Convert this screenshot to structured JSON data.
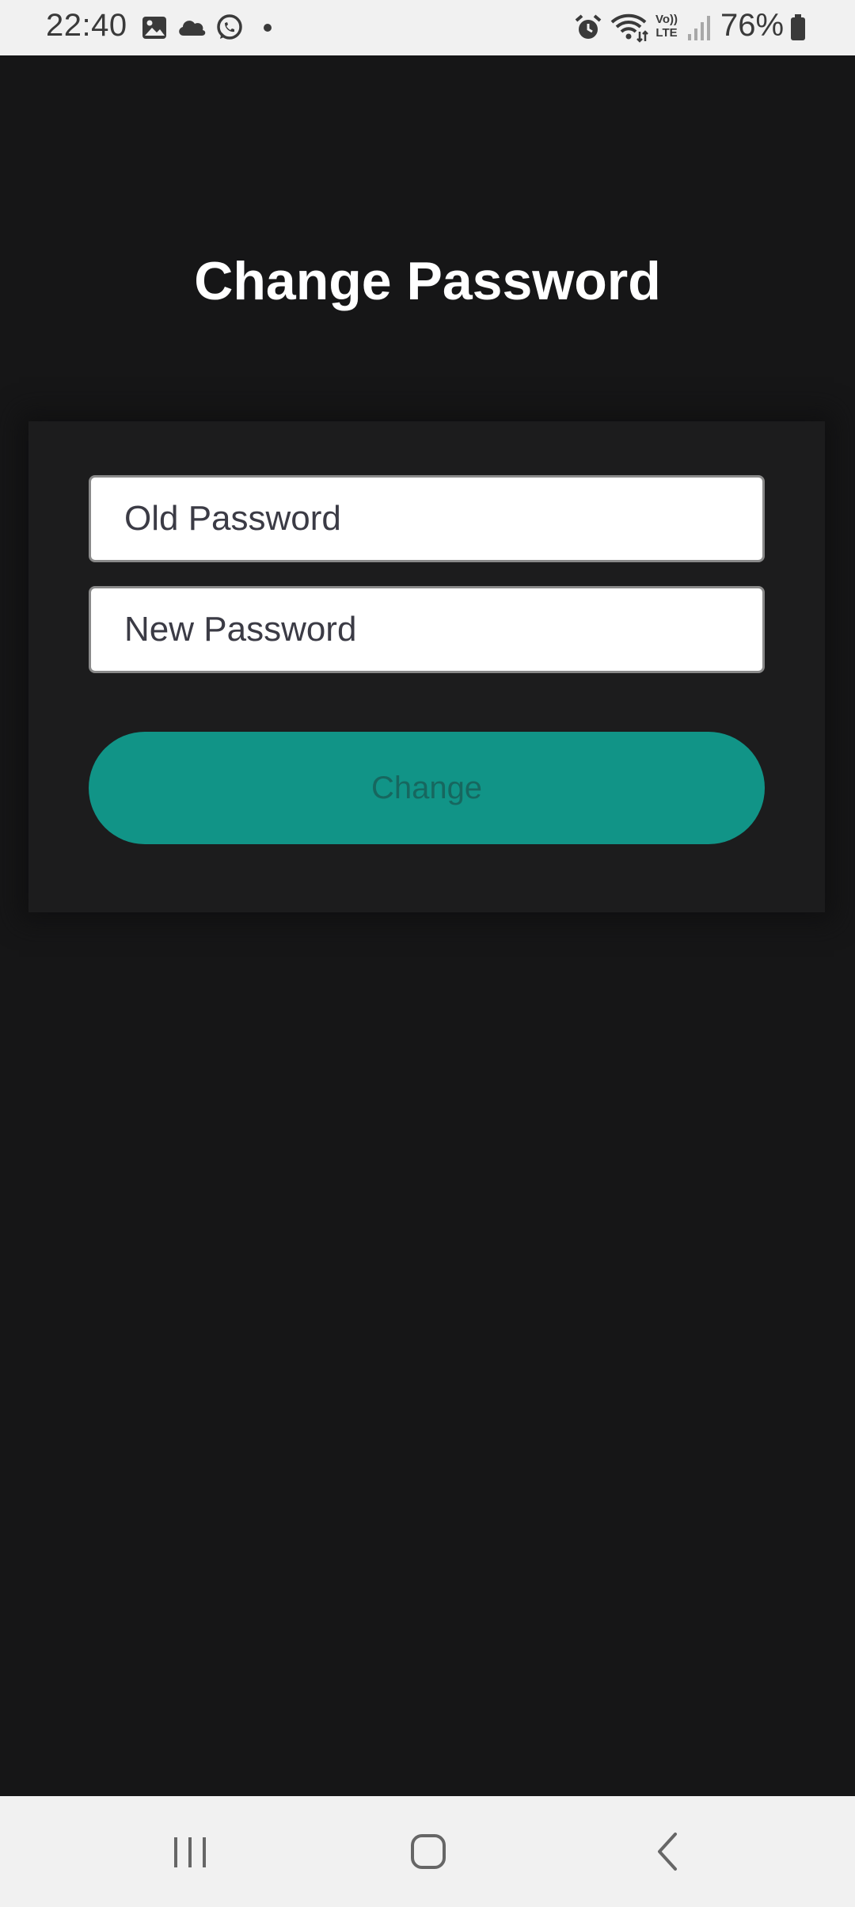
{
  "status_bar": {
    "time": "22:40",
    "battery": "76%",
    "left_icons": [
      "gallery-icon",
      "cloud-icon",
      "whatsapp-icon",
      "dot-icon"
    ],
    "right_icons": [
      "alarm-icon",
      "wifi-icon",
      "volte-icon",
      "signal-icon",
      "battery-icon"
    ],
    "volte_label_top": "Vo))",
    "volte_label_bottom": "LTE"
  },
  "page": {
    "title": "Change Password"
  },
  "form": {
    "old_password_placeholder": "Old Password",
    "new_password_placeholder": "New Password",
    "change_label": "Change"
  },
  "nav_bar": {
    "icons": [
      "recent-apps-icon",
      "home-icon",
      "back-icon"
    ]
  },
  "colors": {
    "background": "#161617",
    "card": "#1c1c1d",
    "accent": "#119487",
    "button_text": "#17675f"
  }
}
